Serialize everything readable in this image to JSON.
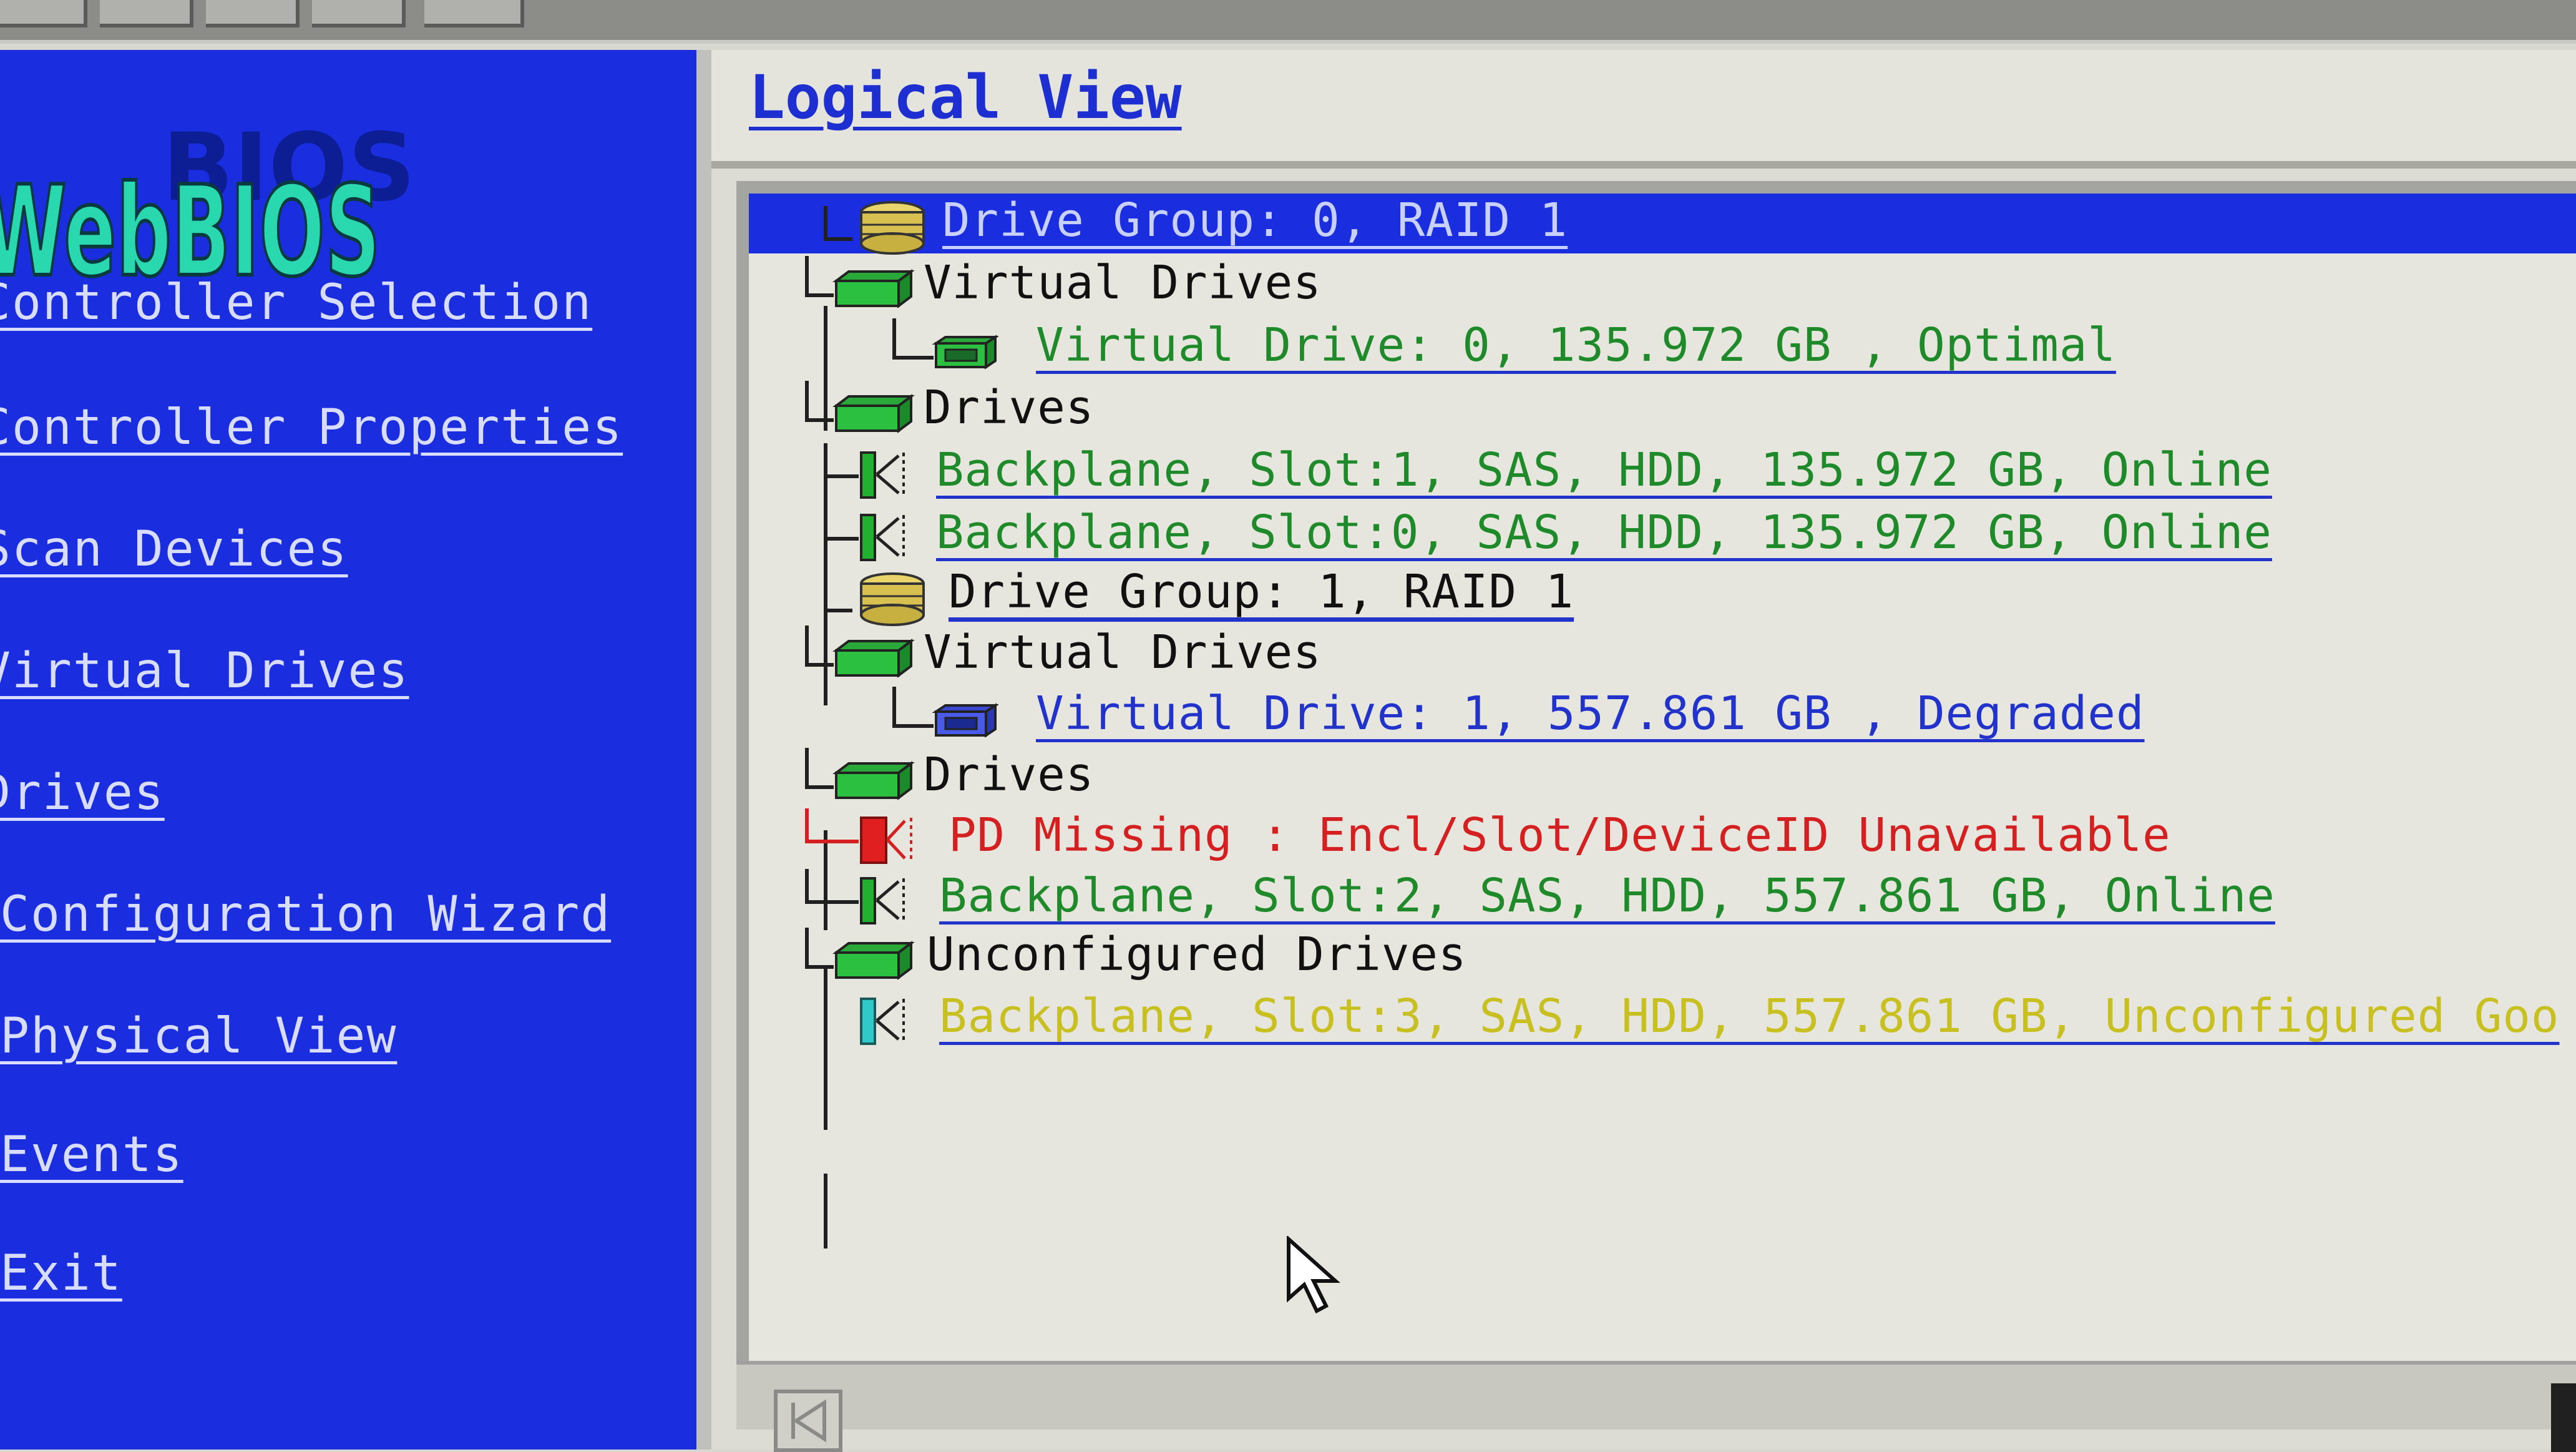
{
  "sidebar": {
    "logo_text": "WebBIOS",
    "items": [
      {
        "label": "Controller Selection"
      },
      {
        "label": "Controller Properties"
      },
      {
        "label": "Scan Devices"
      },
      {
        "label": "Virtual Drives"
      },
      {
        "label": "Drives"
      },
      {
        "label": "Configuration Wizard"
      },
      {
        "label": "Physical View"
      },
      {
        "label": "Events"
      },
      {
        "label": "Exit"
      }
    ]
  },
  "main": {
    "title": "Logical View",
    "tree": {
      "dg0": "Drive Group: 0, RAID 1",
      "dg0_vd_header": "Virtual Drives",
      "dg0_vd0": "Virtual Drive: 0, 135.972 GB , Optimal",
      "dg0_drives_header": "Drives",
      "dg0_drive1": "Backplane, Slot:1, SAS, HDD, 135.972 GB, Online",
      "dg0_drive0": "Backplane, Slot:0, SAS, HDD, 135.972 GB, Online",
      "dg1": "Drive Group: 1, RAID 1",
      "dg1_vd_header": "Virtual Drives",
      "dg1_vd1": "Virtual Drive: 1, 557.861 GB , Degraded",
      "dg1_drives_header": "Drives",
      "dg1_missing": "PD Missing : Encl/Slot/DeviceID Unavailable",
      "dg1_drive2": "Backplane, Slot:2, SAS, HDD, 557.861 GB, Online",
      "unconf_header": "Unconfigured Drives",
      "unconf_drive3": "Backplane, Slot:3, SAS, HDD, 557.861 GB, Unconfigured Goo"
    }
  },
  "colors": {
    "sidebar_bg": "#1a2ee0",
    "selection_bg": "#1a2ee0",
    "online_text": "#1f8a2a",
    "virtual_drive_text": "#2233cc",
    "missing_text": "#d42020",
    "unconfigured_text": "#c8c020"
  }
}
